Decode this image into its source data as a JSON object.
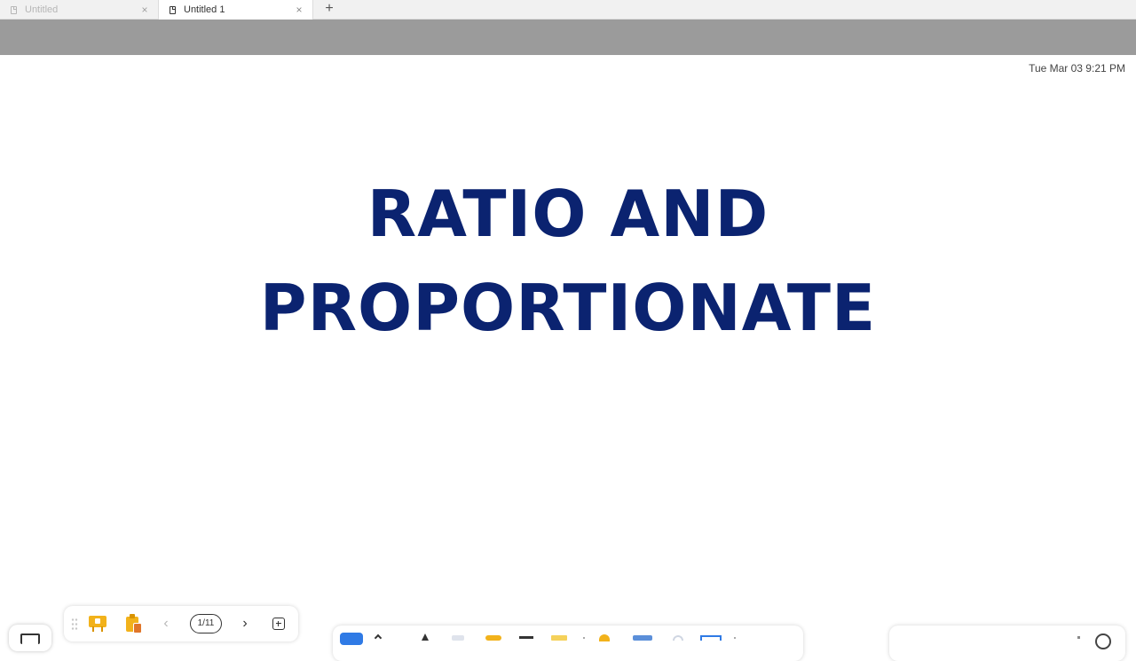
{
  "tabs": [
    {
      "label": "Untitled",
      "state": "inactive"
    },
    {
      "label": "Untitled 1",
      "state": "active"
    }
  ],
  "icons": {
    "document": "document-icon",
    "close": "close-icon",
    "new_tab": "plus-icon"
  },
  "glyphs": {
    "close": "×",
    "new_tab": "+",
    "prev": "‹",
    "next": "›"
  },
  "canvas": {
    "clock": "Tue Mar 03 9:21 PM",
    "title_line1": "RATIO AND",
    "title_line2": "PROPORTIONATE"
  },
  "pager": {
    "page_indicator": "1/11"
  },
  "colors": {
    "title": "#0b2370",
    "graybar": "#9b9b9b",
    "accent_yellow": "#f2b21b",
    "accent_blue": "#2f7ae5"
  }
}
